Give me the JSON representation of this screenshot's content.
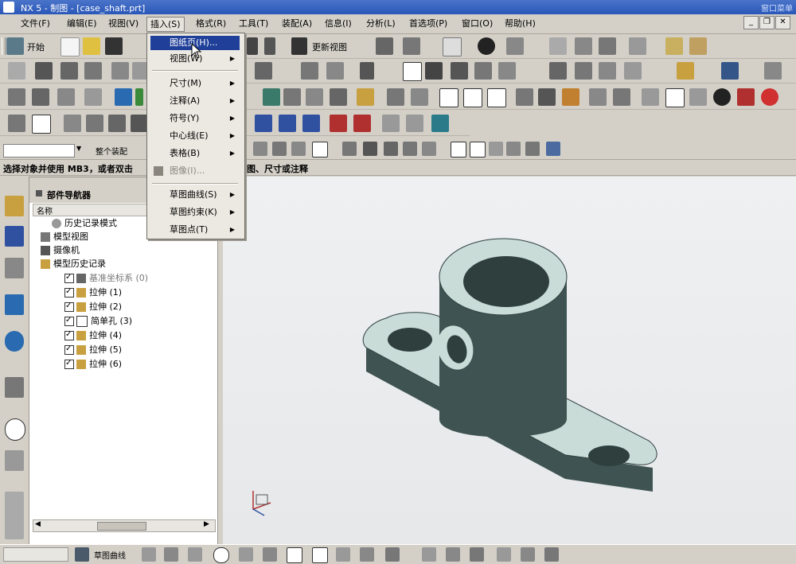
{
  "window": {
    "title": "NX 5 - 制图 - [case_shaft.prt]",
    "title_right": "窗口菜单"
  },
  "menubar": {
    "items": [
      {
        "label": "文件(F)"
      },
      {
        "label": "编辑(E)"
      },
      {
        "label": "视图(V)"
      },
      {
        "label": "插入(S)"
      },
      {
        "label": "格式(R)"
      },
      {
        "label": "工具(T)"
      },
      {
        "label": "装配(A)"
      },
      {
        "label": "信息(I)"
      },
      {
        "label": "分析(L)"
      },
      {
        "label": "首选项(P)"
      },
      {
        "label": "窗口(O)"
      },
      {
        "label": "帮助(H)"
      }
    ],
    "window_controls": [
      "_",
      "❐",
      "✕"
    ]
  },
  "insert_menu": {
    "items": [
      {
        "label": "图纸页(H)...",
        "highlighted": true,
        "submenu": false,
        "disabled": false
      },
      {
        "label": "视图(W)",
        "highlighted": false,
        "submenu": true,
        "disabled": false
      },
      {
        "label": "尺寸(M)",
        "highlighted": false,
        "submenu": true,
        "disabled": false
      },
      {
        "label": "注释(A)",
        "highlighted": false,
        "submenu": true,
        "disabled": false
      },
      {
        "label": "符号(Y)",
        "highlighted": false,
        "submenu": true,
        "disabled": false
      },
      {
        "label": "中心线(E)",
        "highlighted": false,
        "submenu": true,
        "disabled": false
      },
      {
        "label": "表格(B)",
        "highlighted": false,
        "submenu": true,
        "disabled": false
      },
      {
        "label": "图像(I)...",
        "highlighted": false,
        "submenu": false,
        "disabled": true
      },
      {
        "label": "草图曲线(S)",
        "highlighted": false,
        "submenu": true,
        "disabled": false
      },
      {
        "label": "草图约束(K)",
        "highlighted": false,
        "submenu": true,
        "disabled": false
      },
      {
        "label": "草图点(T)",
        "highlighted": false,
        "submenu": true,
        "disabled": false
      }
    ]
  },
  "toolbar1": {
    "start_label": "开始",
    "update_label": "更新视图"
  },
  "selbar": {
    "scope_label": "整个装配"
  },
  "prompt": {
    "text": "选择对象并使用 MB3，或者双击",
    "text2": "图、尺寸或注释"
  },
  "navigator": {
    "title": "部件导航器",
    "column": "名称",
    "items": [
      {
        "label": "历史记录模式",
        "indent": 0
      },
      {
        "label": "模型视图",
        "indent": 0
      },
      {
        "label": "摄像机",
        "indent": 0
      },
      {
        "label": "模型历史记录",
        "indent": 0
      },
      {
        "label": "基准坐标系 (0)",
        "indent": 1
      },
      {
        "label": "拉伸 (1)",
        "indent": 1
      },
      {
        "label": "拉伸 (2)",
        "indent": 1
      },
      {
        "label": "简单孔 (3)",
        "indent": 1
      },
      {
        "label": "拉伸 (4)",
        "indent": 1
      },
      {
        "label": "拉伸 (5)",
        "indent": 1
      },
      {
        "label": "拉伸 (6)",
        "indent": 1
      }
    ]
  },
  "bottombar": {
    "label": "草图曲线"
  },
  "colors": {
    "title_bar": "#2a57b8",
    "highlight": "#1f3f99",
    "part": "#3f5452",
    "part_top": "#c9dcd8"
  }
}
